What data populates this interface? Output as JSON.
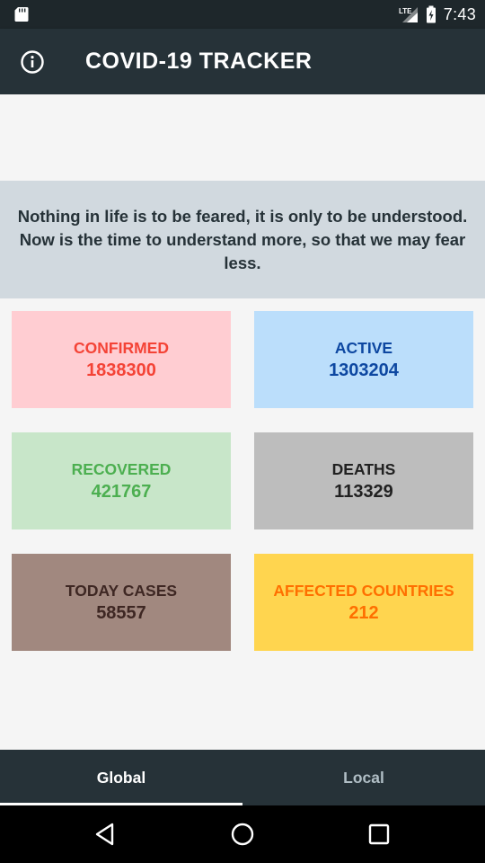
{
  "status_bar": {
    "time": "7:43",
    "network": "LTE",
    "icons": [
      "sd-card-icon",
      "signal-icon",
      "battery-charging-icon"
    ]
  },
  "app_bar": {
    "title": "COVID-19 TRACKER",
    "info_icon": "info-icon"
  },
  "quote": {
    "text": "Nothing in life is to be feared, it is only to be understood. Now is the time to understand more, so that we may fear less."
  },
  "stats": {
    "confirmed": {
      "label": "CONFIRMED",
      "value": "1838300",
      "color": "#f44336",
      "bg": "#ffcdd2"
    },
    "active": {
      "label": "ACTIVE",
      "value": "1303204",
      "color": "#0d47a1",
      "bg": "#bbdefb"
    },
    "recovered": {
      "label": "RECOVERED",
      "value": "421767",
      "color": "#4caf50",
      "bg": "#c8e6c9"
    },
    "deaths": {
      "label": "DEATHS",
      "value": "113329",
      "color": "#212121",
      "bg": "#bdbdbd"
    },
    "today_cases": {
      "label": "TODAY CASES",
      "value": "58557",
      "color": "#3e2723",
      "bg": "#a1887f"
    },
    "affected_countries": {
      "label": "AFFECTED COUNTRIES",
      "value": "212",
      "color": "#ff6f00",
      "bg": "#ffd54f"
    }
  },
  "tabs": [
    {
      "label": "Global",
      "selected": true
    },
    {
      "label": "Local",
      "selected": false
    }
  ],
  "nav": {
    "icons": [
      "back-icon",
      "home-icon",
      "recents-icon"
    ]
  },
  "colors": {
    "app_bar": "#263238",
    "status_bar": "#1e272b",
    "quote_bg": "#d1d9df"
  }
}
